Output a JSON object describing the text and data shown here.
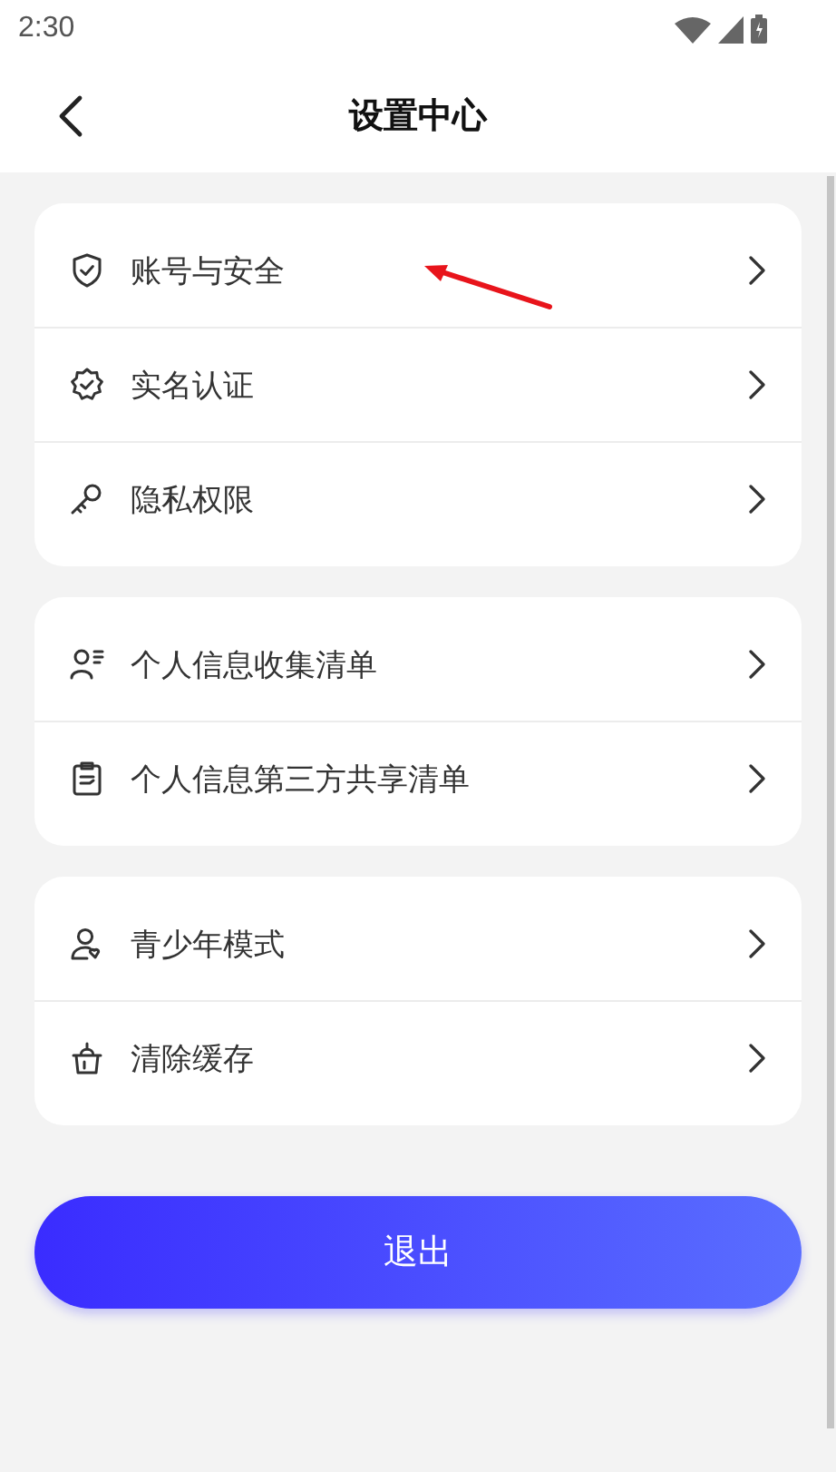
{
  "status_bar": {
    "time": "2:30"
  },
  "header": {
    "title": "设置中心"
  },
  "groups": [
    {
      "items": [
        {
          "label": "账号与安全"
        },
        {
          "label": "实名认证"
        },
        {
          "label": "隐私权限"
        }
      ]
    },
    {
      "items": [
        {
          "label": "个人信息收集清单"
        },
        {
          "label": "个人信息第三方共享清单"
        }
      ]
    },
    {
      "items": [
        {
          "label": "青少年模式"
        },
        {
          "label": "清除缓存"
        }
      ]
    }
  ],
  "logout_button": {
    "label": "退出"
  }
}
